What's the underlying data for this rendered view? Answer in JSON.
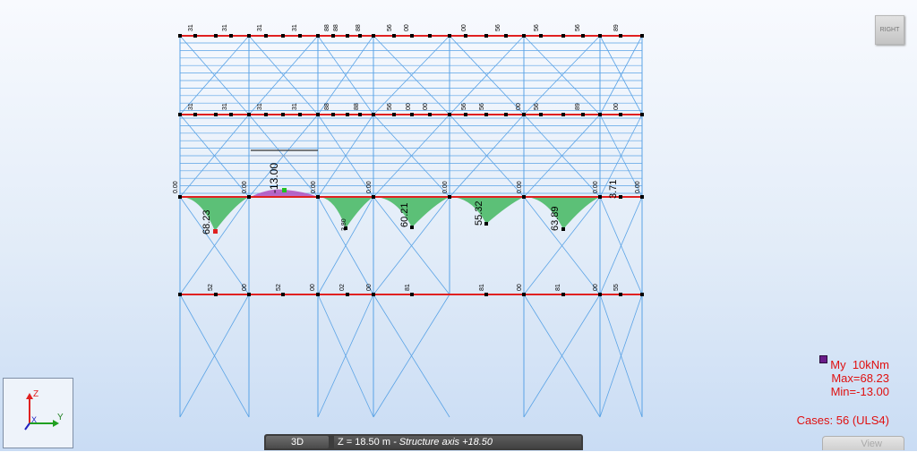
{
  "view": {
    "orientation_button": "RIGHT"
  },
  "levels": [
    {
      "name": "top",
      "labels": [
        "31",
        "31",
        "31",
        "31",
        "88",
        "88",
        "88",
        "56",
        "00",
        "00",
        "56",
        "56",
        "56",
        "89"
      ]
    },
    {
      "name": "upper",
      "labels": [
        "31",
        "31",
        "31",
        "31",
        "88",
        "88",
        "56",
        "00",
        "00",
        "56",
        "56",
        "00",
        "56",
        "89",
        "00"
      ]
    },
    {
      "name": "middle",
      "labels": [
        "0.00",
        "0.00",
        "0.00",
        "0.00",
        "0.00",
        "0.00",
        "0.00",
        "0.00"
      ],
      "values": [
        "68.23",
        "-13.00",
        "3.80",
        "60.21",
        "55.32",
        "63.89",
        "3.71"
      ]
    },
    {
      "name": "lower",
      "labels": [
        "52",
        "00",
        "52",
        "00",
        "02",
        "00",
        "81",
        "81",
        "00",
        "81",
        "00",
        "55"
      ]
    }
  ],
  "legend": {
    "quantity": "My",
    "unit": "10kNm",
    "max": "Max=68.23",
    "min": "Min=-13.00",
    "cases": "Cases: 56 (ULS4)"
  },
  "axes": {
    "z": "Z",
    "x": "X",
    "y": "Y"
  },
  "statusbar": {
    "mode_button": "3D",
    "coordinate": "Z = 18.50 m",
    "hint": " - Structure axis +18.50",
    "view_tab": "View"
  },
  "colors": {
    "beam": "#e02020",
    "frame": "#5aa3e6",
    "positive_fill": "#39b456",
    "negative_fill": "#b050c0"
  }
}
